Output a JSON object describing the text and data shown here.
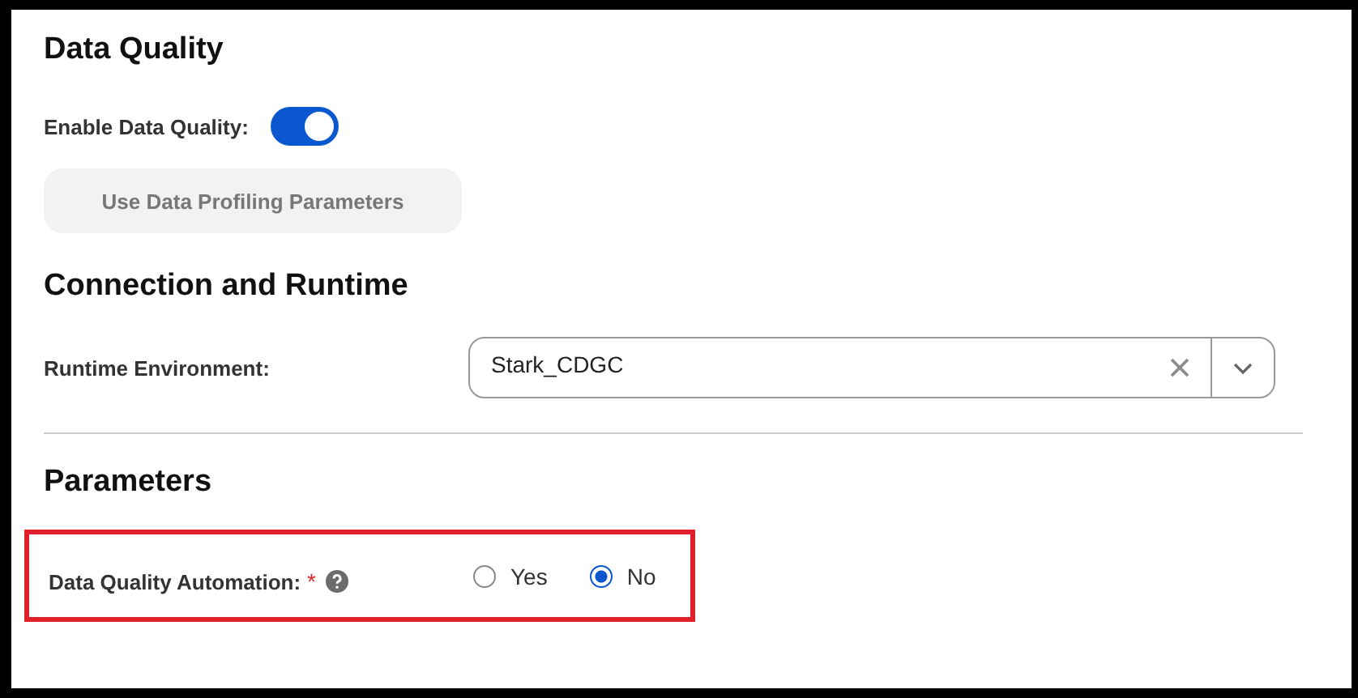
{
  "data_quality": {
    "title": "Data Quality",
    "enable_label": "Enable Data Quality:",
    "enabled": true,
    "profiling_button": {
      "label": "Use Data Profiling Parameters",
      "disabled": true
    }
  },
  "connection": {
    "title": "Connection and Runtime",
    "runtime_label": "Runtime Environment:",
    "runtime_value": "Stark_CDGC"
  },
  "parameters": {
    "title": "Parameters",
    "automation_label": "Data Quality Automation:",
    "required_mark": "*",
    "highlighted": true,
    "options": [
      {
        "label": "Yes",
        "selected": false
      },
      {
        "label": "No",
        "selected": true
      }
    ]
  }
}
